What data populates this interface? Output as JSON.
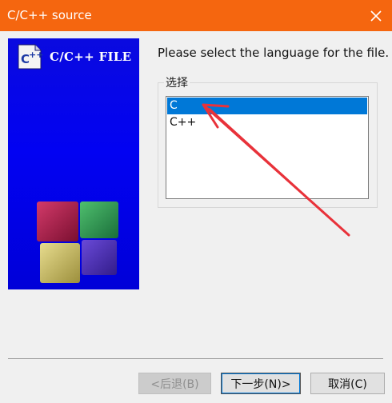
{
  "window": {
    "title": "C/C++ source",
    "close_icon": "close-icon"
  },
  "banner": {
    "title": "C/C++ FILE",
    "logo_icon": "c-plus-plus-file-icon",
    "cubes_icon": "four-cubes-icon"
  },
  "prompt": "Please select the language for the file.",
  "group": {
    "legend": "选择",
    "items": [
      {
        "label": "C",
        "selected": true
      },
      {
        "label": "C++",
        "selected": false
      }
    ]
  },
  "annotation": {
    "icon": "red-arrow-icon",
    "color": "#e8323a"
  },
  "buttons": {
    "back": "<后退(B)",
    "next": "下一步(N)>",
    "cancel": "取消(C)"
  },
  "colors": {
    "titlebar": "#f5660f",
    "selection": "#0078d7",
    "banner": "#0000f0"
  }
}
